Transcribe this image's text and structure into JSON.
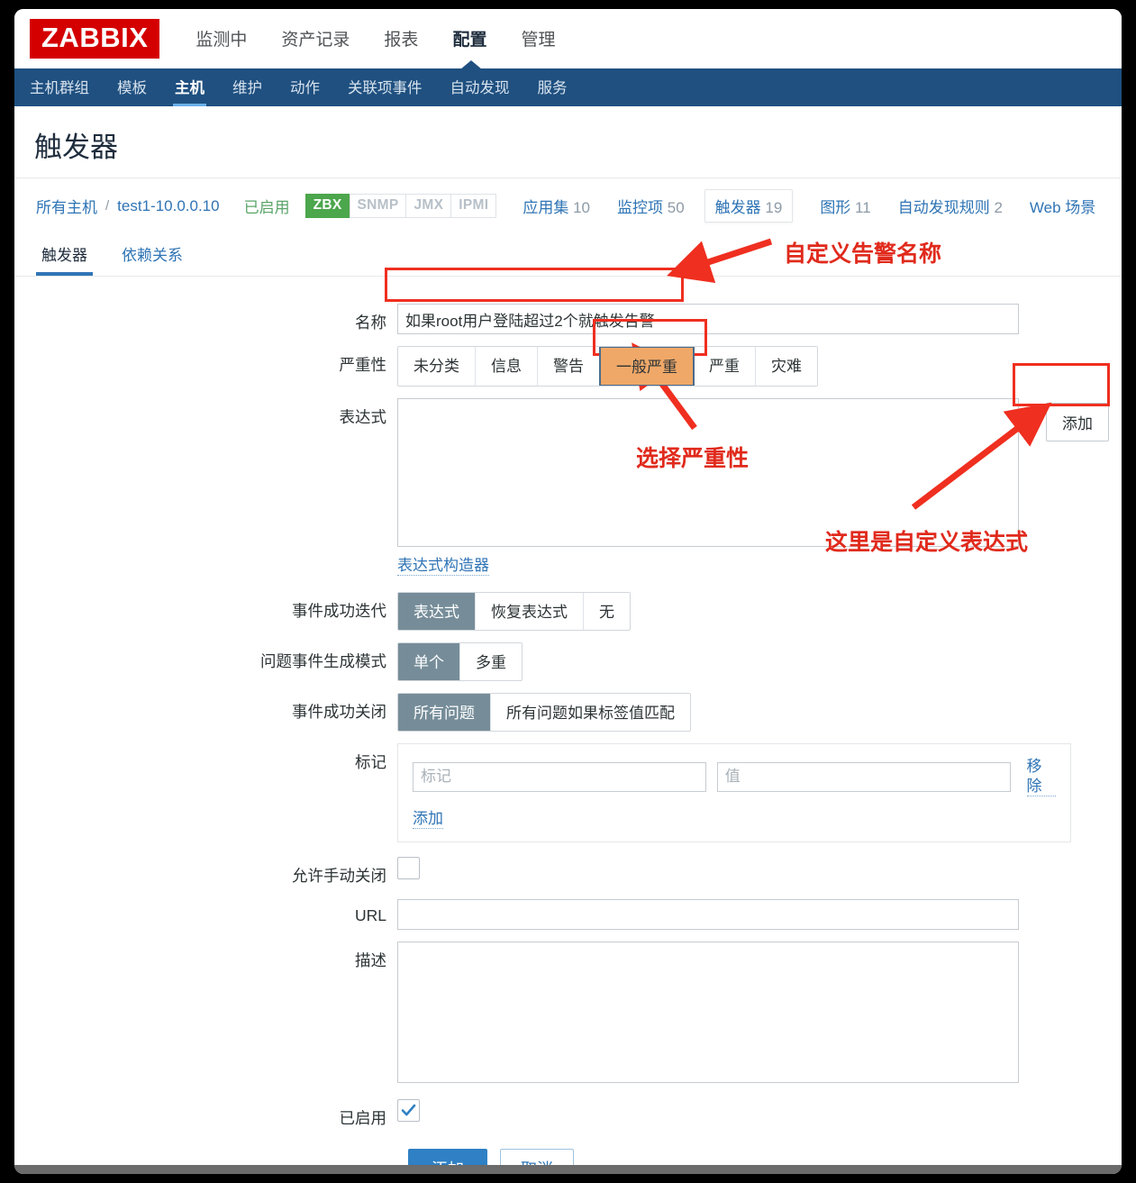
{
  "brand": {
    "logo": "ZABBIX"
  },
  "topnav": {
    "items": [
      {
        "label": "监测中",
        "active": false
      },
      {
        "label": "资产记录",
        "active": false
      },
      {
        "label": "报表",
        "active": false
      },
      {
        "label": "配置",
        "active": true
      },
      {
        "label": "管理",
        "active": false
      }
    ]
  },
  "subnav": {
    "items": [
      {
        "label": "主机群组",
        "active": false
      },
      {
        "label": "模板",
        "active": false
      },
      {
        "label": "主机",
        "active": true
      },
      {
        "label": "维护",
        "active": false
      },
      {
        "label": "动作",
        "active": false
      },
      {
        "label": "关联项事件",
        "active": false
      },
      {
        "label": "自动发现",
        "active": false
      },
      {
        "label": "服务",
        "active": false
      }
    ]
  },
  "page": {
    "title": "触发器"
  },
  "breadcrumb": {
    "host_group": "所有主机",
    "separator": "/",
    "host": "test1-10.0.0.10",
    "status": "已启用",
    "interfaces": [
      {
        "label": "ZBX",
        "enabled": true
      },
      {
        "label": "SNMP",
        "enabled": false
      },
      {
        "label": "JMX",
        "enabled": false
      },
      {
        "label": "IPMI",
        "enabled": false
      }
    ],
    "counts": [
      {
        "label": "应用集",
        "count": "10",
        "selected": false
      },
      {
        "label": "监控项",
        "count": "50",
        "selected": false
      },
      {
        "label": "触发器",
        "count": "19",
        "selected": true
      },
      {
        "label": "图形",
        "count": "11",
        "selected": false
      },
      {
        "label": "自动发现规则",
        "count": "2",
        "selected": false
      },
      {
        "label": "Web 场景",
        "count": "",
        "selected": false
      }
    ]
  },
  "tabs": [
    {
      "label": "触发器",
      "active": true
    },
    {
      "label": "依赖关系",
      "active": false
    }
  ],
  "form": {
    "name": {
      "label": "名称",
      "value": "如果root用户登陆超过2个就触发告警",
      "placeholder": ""
    },
    "severity": {
      "label": "严重性",
      "options": [
        "未分类",
        "信息",
        "警告",
        "一般严重",
        "严重",
        "灾难"
      ],
      "selected": "一般严重",
      "selected_color": "#f0a868"
    },
    "expression": {
      "label": "表达式",
      "value": "",
      "add_button": "添加",
      "constructor_link": "表达式构造器"
    },
    "ok_event_generation": {
      "label": "事件成功迭代",
      "options": [
        "表达式",
        "恢复表达式",
        "无"
      ],
      "selected": "表达式"
    },
    "problem_event_generation": {
      "label": "问题事件生成模式",
      "options": [
        "单个",
        "多重"
      ],
      "selected": "单个"
    },
    "ok_event_closes": {
      "label": "事件成功关闭",
      "options": [
        "所有问题",
        "所有问题如果标签值匹配"
      ],
      "selected": "所有问题"
    },
    "tags": {
      "label": "标记",
      "tag_placeholder": "标记",
      "value_placeholder": "值",
      "remove_label": "移除",
      "add_label": "添加",
      "tag_value": "",
      "value_value": ""
    },
    "allow_manual_close": {
      "label": "允许手动关闭",
      "checked": false
    },
    "url": {
      "label": "URL",
      "value": ""
    },
    "description": {
      "label": "描述",
      "value": ""
    },
    "enabled": {
      "label": "已启用",
      "checked": true
    },
    "submit": "添加",
    "cancel": "取消"
  },
  "annotations": [
    {
      "id": "name",
      "text": "自定义告警名称",
      "color": "#e02a1c"
    },
    {
      "id": "severity",
      "text": "选择严重性",
      "color": "#e02a1c"
    },
    {
      "id": "expression",
      "text": "这里是自定义表达式",
      "color": "#e02a1c"
    }
  ]
}
